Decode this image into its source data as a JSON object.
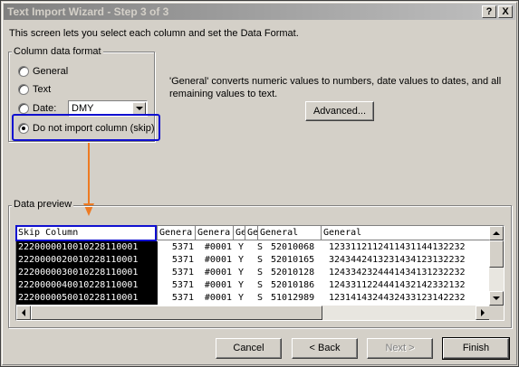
{
  "window": {
    "title": "Text Import Wizard - Step 3 of 3",
    "help_label": "?",
    "close_label": "X"
  },
  "intro": "This screen lets you select each column and set the Data Format.",
  "format_group": {
    "label": "Column data format",
    "options": {
      "general": "General",
      "text": "Text",
      "date": "Date:",
      "skip": "Do not import column (skip)"
    },
    "selected": "skip",
    "date_value": "DMY"
  },
  "description": "'General' converts numeric values to numbers, date values to dates, and all remaining values to text.",
  "advanced_button": "Advanced...",
  "preview": {
    "label": "Data preview",
    "headers": [
      "Skip Column",
      "Genera",
      "Genera",
      "Ge",
      "Ge",
      "General",
      "General"
    ],
    "rows": [
      [
        "2220000010010228110001",
        "5371",
        "#0001",
        "Y",
        "S",
        "52010068",
        "1233112112411431144132232"
      ],
      [
        "2220000020010228110001",
        "5371",
        "#0001",
        "Y",
        "S",
        "52010165",
        "3243442413231434123132232"
      ],
      [
        "2220000030010228110001",
        "5371",
        "#0001",
        "Y",
        "S",
        "52010128",
        "1243342324441434131232232"
      ],
      [
        "2220000040010228110001",
        "5371",
        "#0001",
        "Y",
        "S",
        "52010186",
        "1243311224441432142332132"
      ],
      [
        "2220000050010228110001",
        "5371",
        "#0001",
        "Y",
        "S",
        "51012989",
        "1231414324432433123142232"
      ]
    ]
  },
  "buttons": {
    "cancel": "Cancel",
    "back": "< Back",
    "next": "Next >",
    "finish": "Finish"
  },
  "colors": {
    "highlight_border": "#1010d0",
    "arrow": "#ee7a22"
  }
}
